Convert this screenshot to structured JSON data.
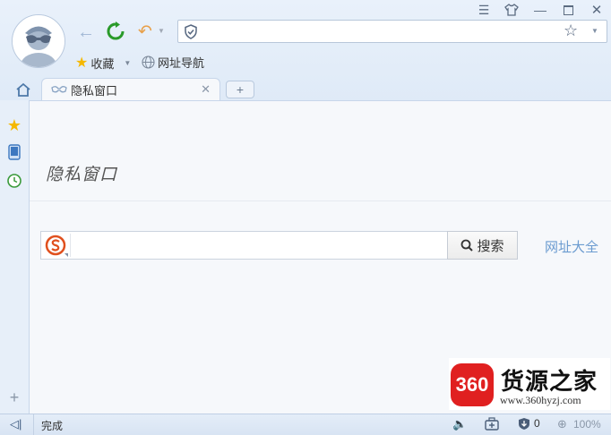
{
  "toolbar": {
    "favorites_label": "收藏",
    "nav_label": "网址导航"
  },
  "tab": {
    "title": "隐私窗口"
  },
  "page": {
    "title": "隐私窗口",
    "search_button": "搜索",
    "sites_link": "网址大全"
  },
  "status": {
    "text": "完成",
    "download_count": "0",
    "zoom": "100%"
  },
  "watermark": {
    "logo_number": "360",
    "brand_text": "货源之家",
    "url": "www.360hyzj.com"
  },
  "colors": {
    "refresh_green": "#2a9a2a",
    "undo_orange": "#e8a04a",
    "star_yellow": "#f5b800",
    "search_logo_orange": "#e0501e",
    "link_blue": "#6b9bd0",
    "watermark_red": "#e02020"
  }
}
